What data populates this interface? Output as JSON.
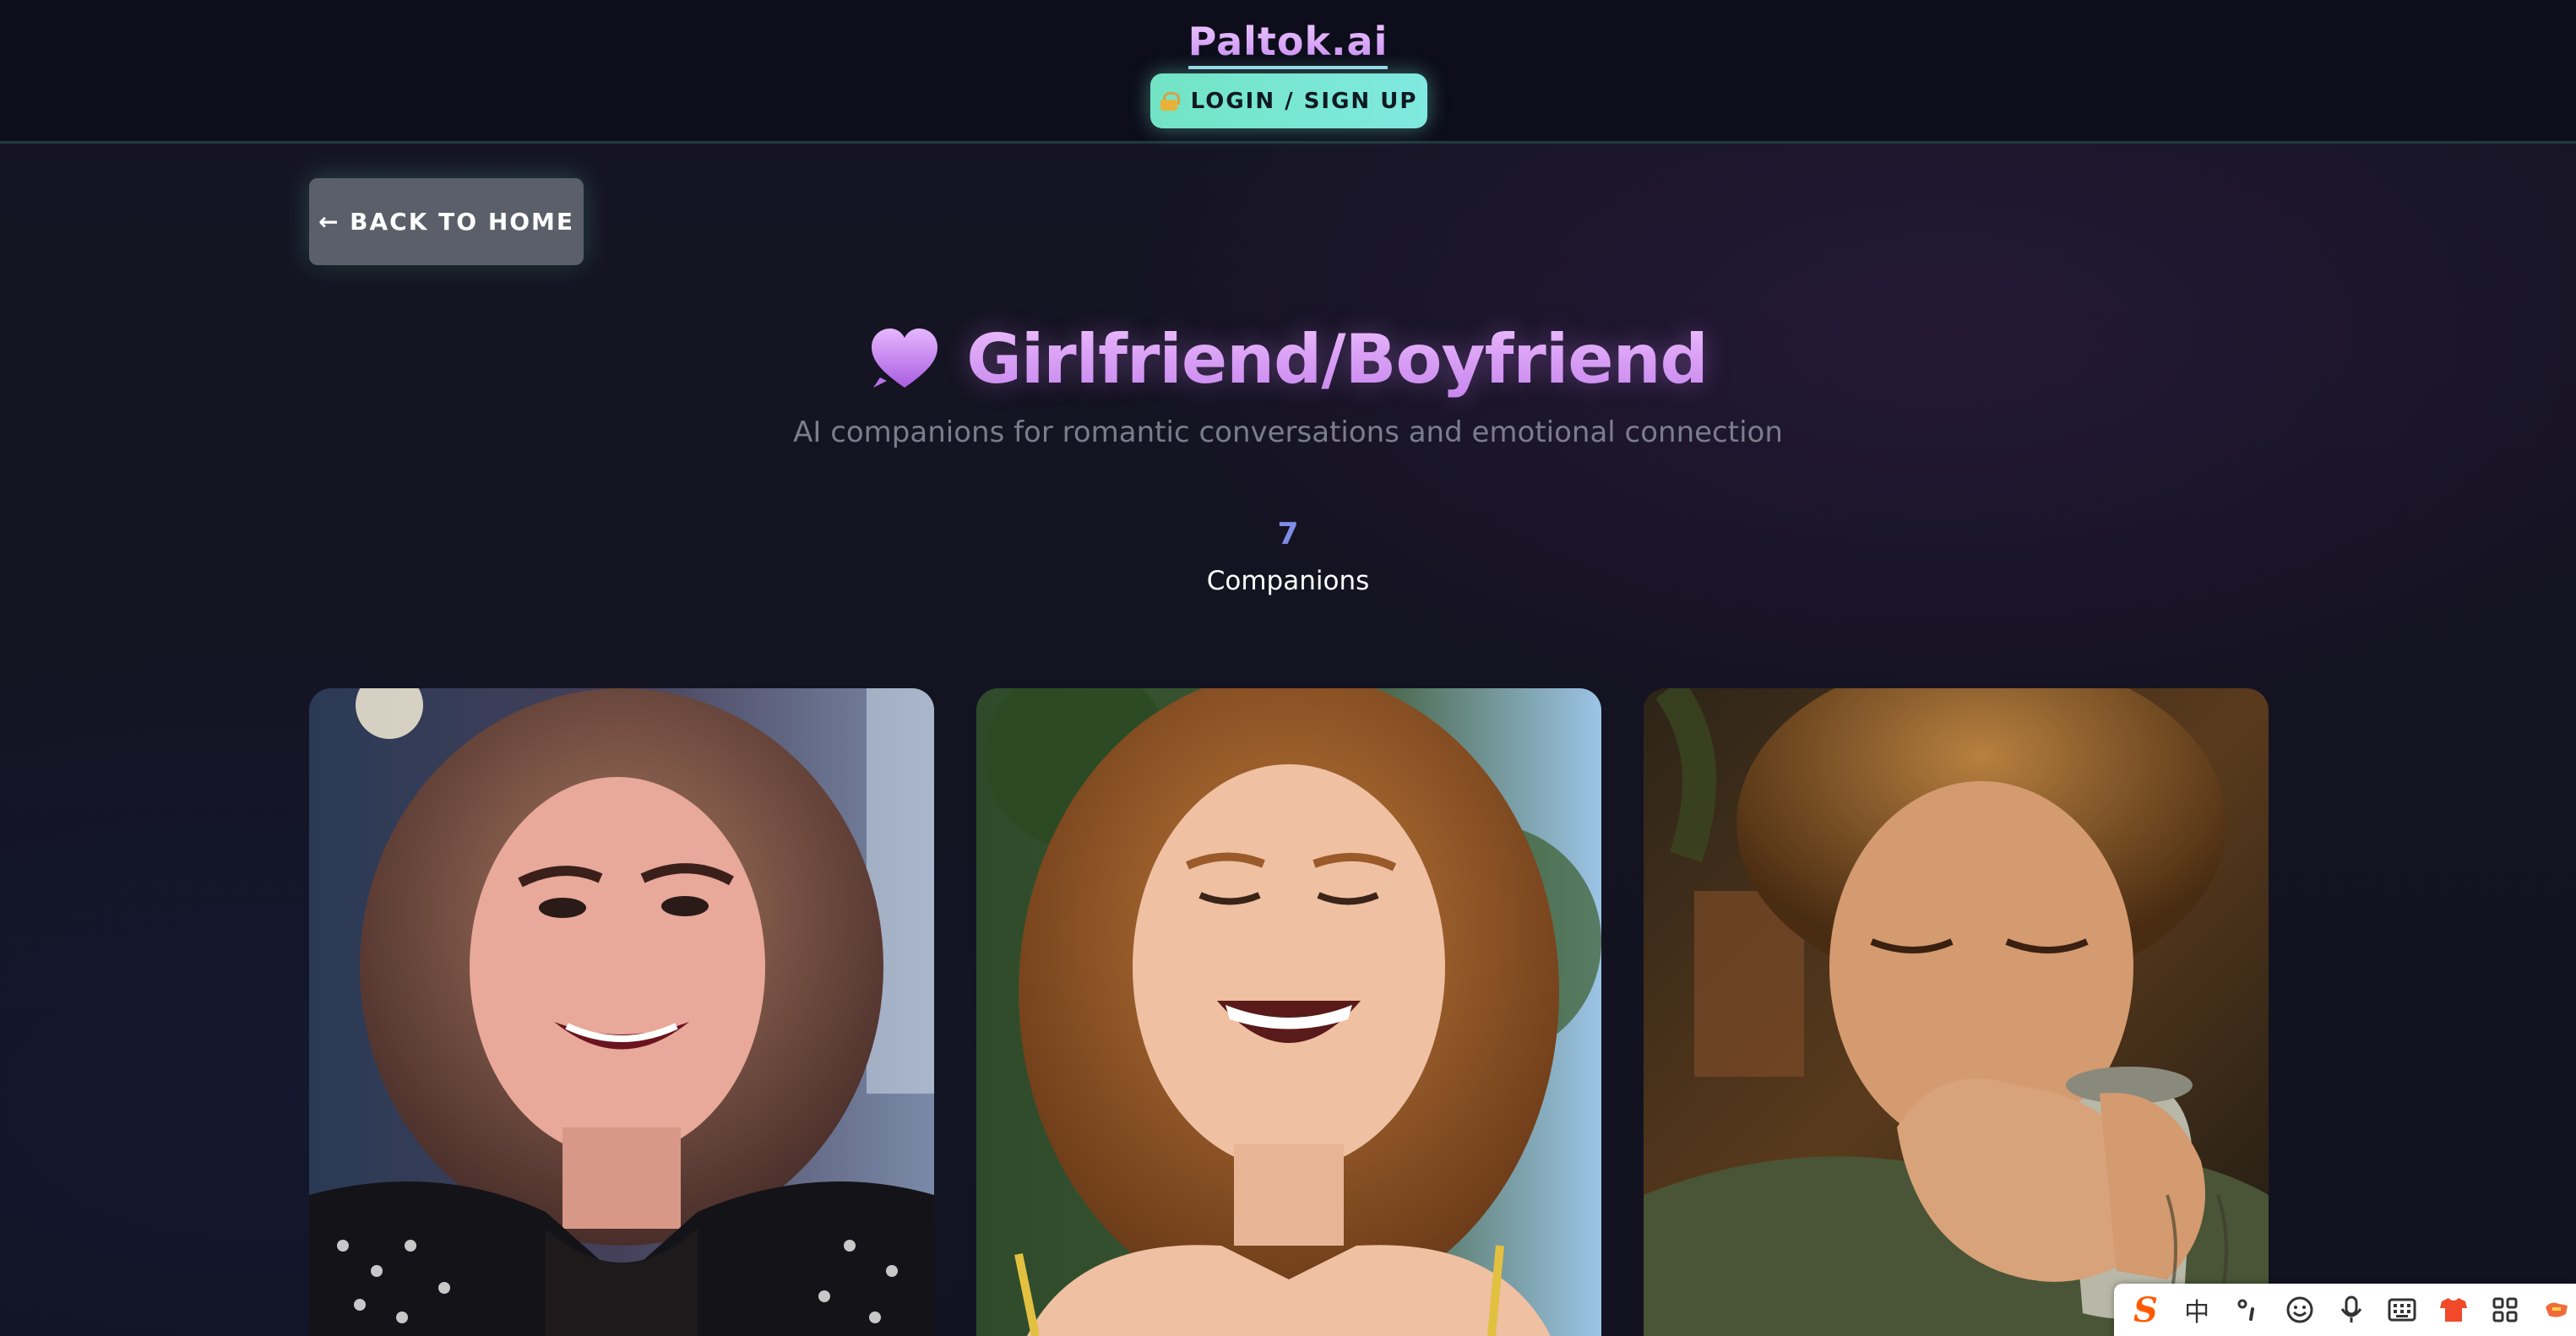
{
  "header": {
    "brand": "Paltok.ai",
    "login_label": "LOGIN / SIGN UP",
    "login_icon": "lock-icon"
  },
  "nav": {
    "back_label": "← BACK TO HOME"
  },
  "category": {
    "icon": "purple-heart-icon",
    "title": "Girlfriend/Boyfriend",
    "subtitle": "AI companions for romantic conversations and emotional connection",
    "count": "7",
    "count_label": "Companions"
  },
  "companions": [
    {
      "image": "woman-leather-jacket-portrait"
    },
    {
      "image": "woman-red-hair-laughing-portrait"
    },
    {
      "image": "man-curly-hair-drinking-mug-portrait"
    }
  ],
  "ime_toolbar": {
    "logo": "S",
    "lang": "中",
    "items": [
      "punctuation-icon",
      "emoji-icon",
      "microphone-icon",
      "keyboard-icon",
      "skin-icon",
      "grid-icon",
      "tool-icon"
    ]
  },
  "colors": {
    "brand": "#d9a8ff",
    "accent_teal": "#72e4c4",
    "count": "#7f8ce8"
  }
}
